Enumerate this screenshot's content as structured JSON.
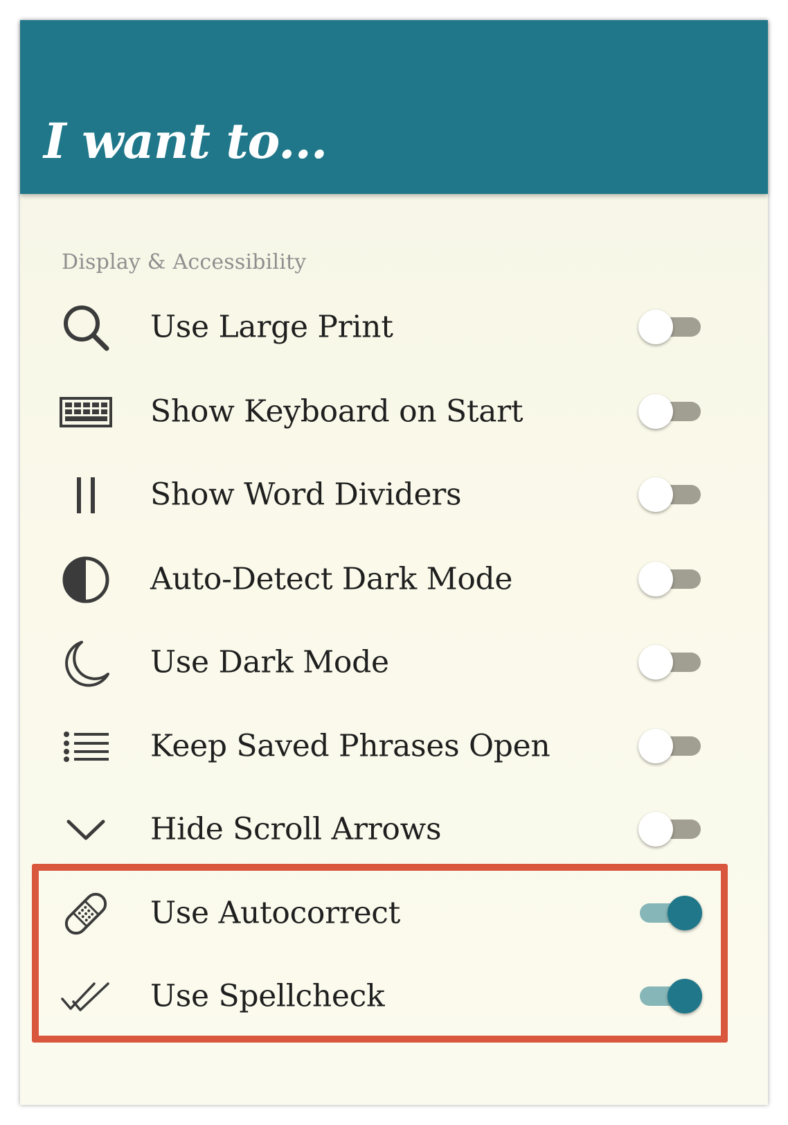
{
  "header": {
    "title": "I want to..."
  },
  "section": {
    "label": "Display & Accessibility"
  },
  "rows": [
    {
      "label": "Use Large Print",
      "icon": "magnifier-icon",
      "enabled": false
    },
    {
      "label": "Show Keyboard on Start",
      "icon": "keyboard-icon",
      "enabled": false
    },
    {
      "label": "Show Word Dividers",
      "icon": "word-divider-icon",
      "enabled": false
    },
    {
      "label": "Auto-Detect Dark Mode",
      "icon": "half-circle-contrast-icon",
      "enabled": false
    },
    {
      "label": "Use Dark Mode",
      "icon": "crescent-moon-icon",
      "enabled": false
    },
    {
      "label": "Keep Saved Phrases Open",
      "icon": "list-icon",
      "enabled": false
    },
    {
      "label": "Hide Scroll Arrows",
      "icon": "chevron-down-icon",
      "enabled": false
    },
    {
      "label": "Use Autocorrect",
      "icon": "bandage-icon",
      "enabled": true
    },
    {
      "label": "Use Spellcheck",
      "icon": "double-check-icon",
      "enabled": true
    }
  ],
  "colors": {
    "header_bg": "#1f7789",
    "toggle_on": "#1f7789",
    "toggle_off_track": "#a19f91",
    "highlight_border": "#d9573c",
    "panel_bg": "#f8f7e9"
  }
}
